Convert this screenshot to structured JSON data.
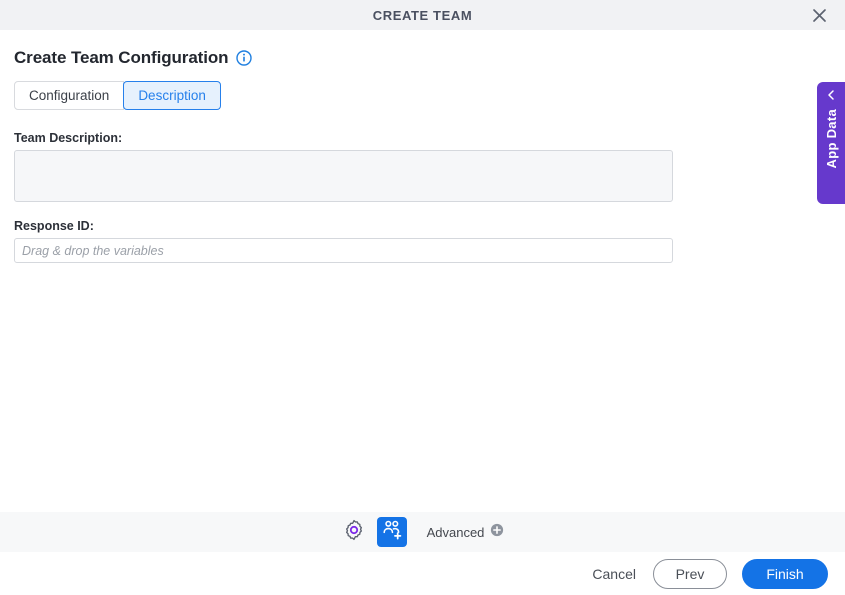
{
  "window": {
    "title": "CREATE TEAM",
    "close_icon": "close-icon"
  },
  "page": {
    "title": "Create Team Configuration",
    "info_icon": "info-icon"
  },
  "tabs": [
    {
      "label": "Configuration",
      "active": false
    },
    {
      "label": "Description",
      "active": true
    }
  ],
  "fields": {
    "team_description": {
      "label": "Team Description:",
      "value": "",
      "placeholder": ""
    },
    "response_id": {
      "label": "Response ID:",
      "value": "",
      "placeholder": "Drag & drop the variables"
    }
  },
  "app_data_tab": {
    "label": "App Data",
    "chevron_icon": "chevron-left-icon"
  },
  "toolbar": {
    "gear_icon": "gear-icon",
    "team_icon": "add-team-icon",
    "advanced_label": "Advanced",
    "advanced_icon": "plus-circle-icon"
  },
  "footer": {
    "cancel_label": "Cancel",
    "prev_label": "Prev",
    "finish_label": "Finish"
  },
  "colors": {
    "accent_blue": "#1473e6",
    "tab_blue": "#2680eb",
    "app_data_purple": "#6639cc",
    "gear_purple": "#7d2ae8",
    "titlebar_bg": "#f1f2f4",
    "toolbar_bg": "#f7f8f9"
  }
}
